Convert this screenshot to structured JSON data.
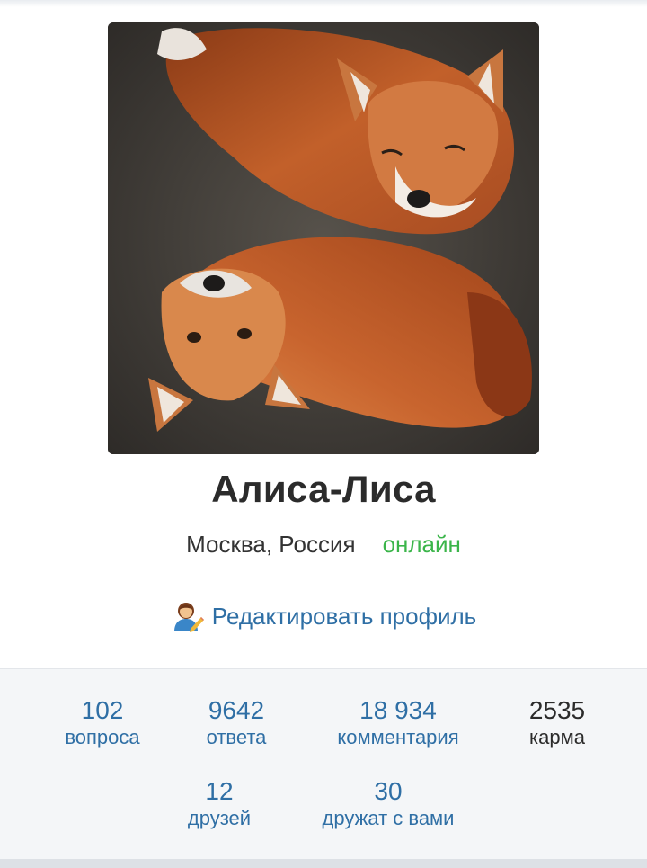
{
  "profile": {
    "name": "Алиса-Лиса",
    "location": "Москва, Россия",
    "status": "онлайн",
    "status_color": "#3bb54a",
    "edit_label": "Редактировать профиль",
    "edit_icon": "person-with-pencil-icon",
    "avatar": "photo-of-two-red-foxes"
  },
  "stats": {
    "questions": {
      "value": "102",
      "label": "вопроса"
    },
    "answers": {
      "value": "9642",
      "label": "ответа"
    },
    "comments": {
      "value": "18 934",
      "label": "комментария"
    },
    "karma": {
      "value": "2535",
      "label": "карма"
    },
    "friends": {
      "value": "12",
      "label": "друзей"
    },
    "followers": {
      "value": "30",
      "label": "дружат с вами"
    }
  },
  "colors": {
    "link": "#2f6fa5",
    "text": "#2b2b2b",
    "panel": "#f4f6f8"
  }
}
